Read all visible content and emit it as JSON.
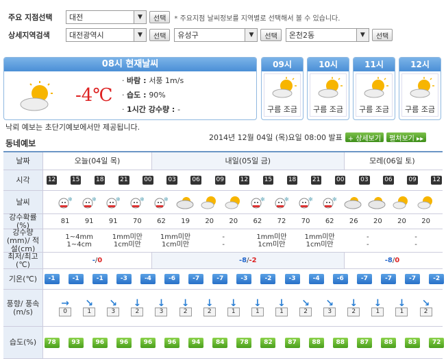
{
  "search": {
    "row1_label": "주요 지점선택",
    "row1_select": "대전",
    "row1_btn": "선택",
    "row1_note": "* 주요지점 날씨정보를 지역별로 선택해서 볼 수 있습니다.",
    "row2_label": "상세지역검색",
    "sel_a": "대전광역시",
    "sel_b": "유성구",
    "sel_c": "온천2동",
    "btn": "선택"
  },
  "current": {
    "title": "08시 현재날씨",
    "temp": "-4℃",
    "wind_label": "바람 : ",
    "wind": "서풍 1m/s",
    "hum_label": "습도 : ",
    "hum": "90%",
    "rain_label": "1시간 강수량 : ",
    "rain": "-"
  },
  "hourly": [
    {
      "hour": "09시",
      "weather": "구름 조금"
    },
    {
      "hour": "10시",
      "weather": "구름 조금"
    },
    {
      "hour": "11시",
      "weather": "구름 조금"
    },
    {
      "hour": "12시",
      "weather": "구름 조금"
    }
  ],
  "notice": "낙뢰 예보는 초단기예보에서만 제공됩니다.",
  "section_title": "동네예보",
  "issued": "2014년 12월 04일 (목)요일 08:00 발표",
  "btn_detail": "+ 상세보기",
  "btn_expand": "펼쳐보기 ▸▸",
  "table": {
    "headers": {
      "date": "날짜",
      "time": "시각",
      "weather": "날씨",
      "prob": "강수확률(%)",
      "amount": "강수량(mm)/ 적설(cm)",
      "minmax": "최저/최고(℃)",
      "temp": "기온(℃)",
      "wind": "풍향/ 풍속(m/s)",
      "hum": "습도(%)"
    },
    "days": [
      "오늘(04일 목)",
      "내일(05일 금)",
      "모레(06일 토)"
    ],
    "times": [
      "12",
      "15",
      "18",
      "21",
      "00",
      "03",
      "06",
      "09",
      "12",
      "15",
      "18",
      "21",
      "00",
      "03",
      "06",
      "09",
      "12"
    ],
    "icons": [
      "snow",
      "snow",
      "snow",
      "snow",
      "snow",
      "cloud",
      "psun",
      "psun",
      "snow",
      "snow",
      "snow",
      "snow",
      "cloud",
      "cloud",
      "psun",
      "psun"
    ],
    "prob": [
      "81",
      "91",
      "91",
      "70",
      "62",
      "19",
      "20",
      "20",
      "62",
      "72",
      "70",
      "62",
      "26",
      "20",
      "20",
      "20"
    ],
    "amount": [
      {
        "t": "1~4mm\n1~4cm"
      },
      {
        "t": "1mm미만\n1cm미만"
      },
      {
        "t": "1mm미만\n1cm미만"
      },
      {
        "t": "-\n-"
      },
      {
        "t": "1mm미만\n1cm미만"
      },
      {
        "t": "1mm미만\n1cm미만"
      },
      {
        "t": "-\n-"
      },
      {
        "t": "-\n-"
      }
    ],
    "minmax": [
      {
        "min": "-",
        "max": "0"
      },
      {
        "min": "-8",
        "max": "-2"
      },
      {
        "min": "-8",
        "max": "0"
      }
    ],
    "temps": [
      "-1",
      "-1",
      "-1",
      "-3",
      "-4",
      "-6",
      "-7",
      "-7",
      "-3",
      "-2",
      "-3",
      "-4",
      "-6",
      "-7",
      "-7",
      "-7",
      "-2"
    ],
    "wind_dir": [
      "→",
      "↘",
      "↘",
      "↓",
      "↓",
      "↓",
      "↓",
      "↓",
      "↓",
      "↓",
      "↘",
      "↘",
      "↓",
      "↓",
      "↓",
      "↘"
    ],
    "wind_speed": [
      "0",
      "1",
      "3",
      "2",
      "3",
      "2",
      "2",
      "1",
      "1",
      "1",
      "2",
      "3",
      "2",
      "1",
      "1",
      "2"
    ],
    "hums": [
      "78",
      "93",
      "96",
      "96",
      "96",
      "96",
      "94",
      "84",
      "78",
      "82",
      "87",
      "88",
      "88",
      "87",
      "88",
      "83",
      "72"
    ]
  }
}
